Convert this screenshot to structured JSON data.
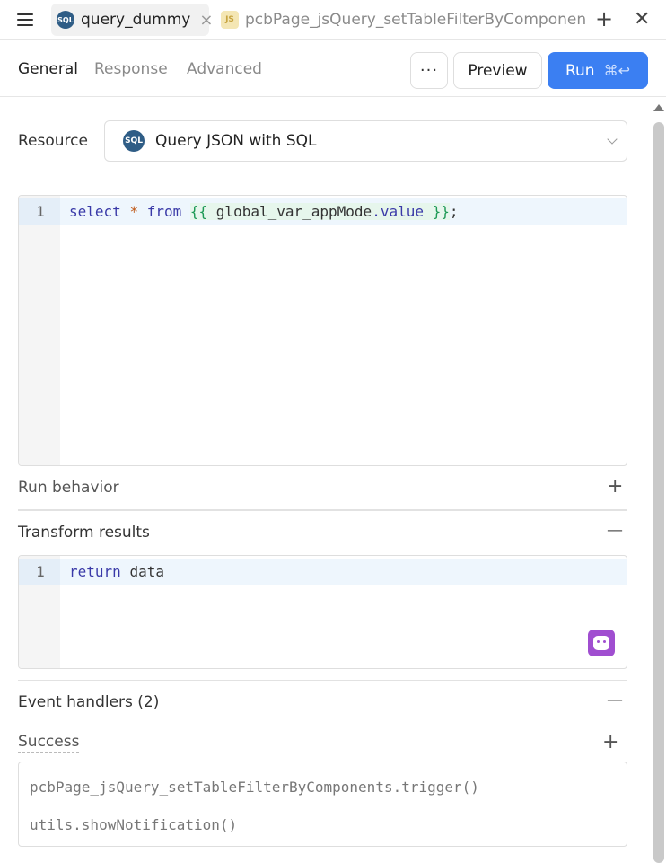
{
  "tabs": {
    "active": {
      "icon": "SQL",
      "label": "query_dummy"
    },
    "inactive": {
      "icon": "JS",
      "label": "pcbPage_jsQuery_setTableFilterByComponents"
    }
  },
  "toolbar": {
    "subtabs": [
      "General",
      "Response",
      "Advanced"
    ],
    "more_label": "···",
    "preview_label": "Preview",
    "run_label": "Run",
    "run_shortcut": "⌘↩"
  },
  "resource": {
    "label": "Resource",
    "icon": "SQL",
    "value": "Query JSON with SQL"
  },
  "query_editor": {
    "line_number": "1",
    "tokens": {
      "kw_select": "select",
      "star": "*",
      "kw_from": "from",
      "tpl_open": "{{",
      "var": "global_var_appMode",
      "prop": ".value",
      "tpl_close": "}}",
      "semi": ";"
    }
  },
  "run_behavior": {
    "title": "Run behavior",
    "toggle": "+"
  },
  "transform": {
    "title": "Transform results",
    "toggle": "—",
    "line_number": "1",
    "kw": "return",
    "rest": "data"
  },
  "event_handlers": {
    "title": "Event handlers (2)",
    "toggle": "—",
    "success_label": "Success",
    "add": "+",
    "items": [
      "pcbPage_jsQuery_setTableFilterByComponents.trigger()",
      "utils.showNotification()"
    ]
  },
  "colors": {
    "accent": "#3b7ff2",
    "sql_icon": "#2f5d86",
    "ai_button": "#a04ed0"
  },
  "icons": [
    "hamburger-icon",
    "sql-icon",
    "js-icon",
    "close-icon",
    "plus-icon",
    "more-icon",
    "chevron-down-icon",
    "ai-assist-icon"
  ]
}
